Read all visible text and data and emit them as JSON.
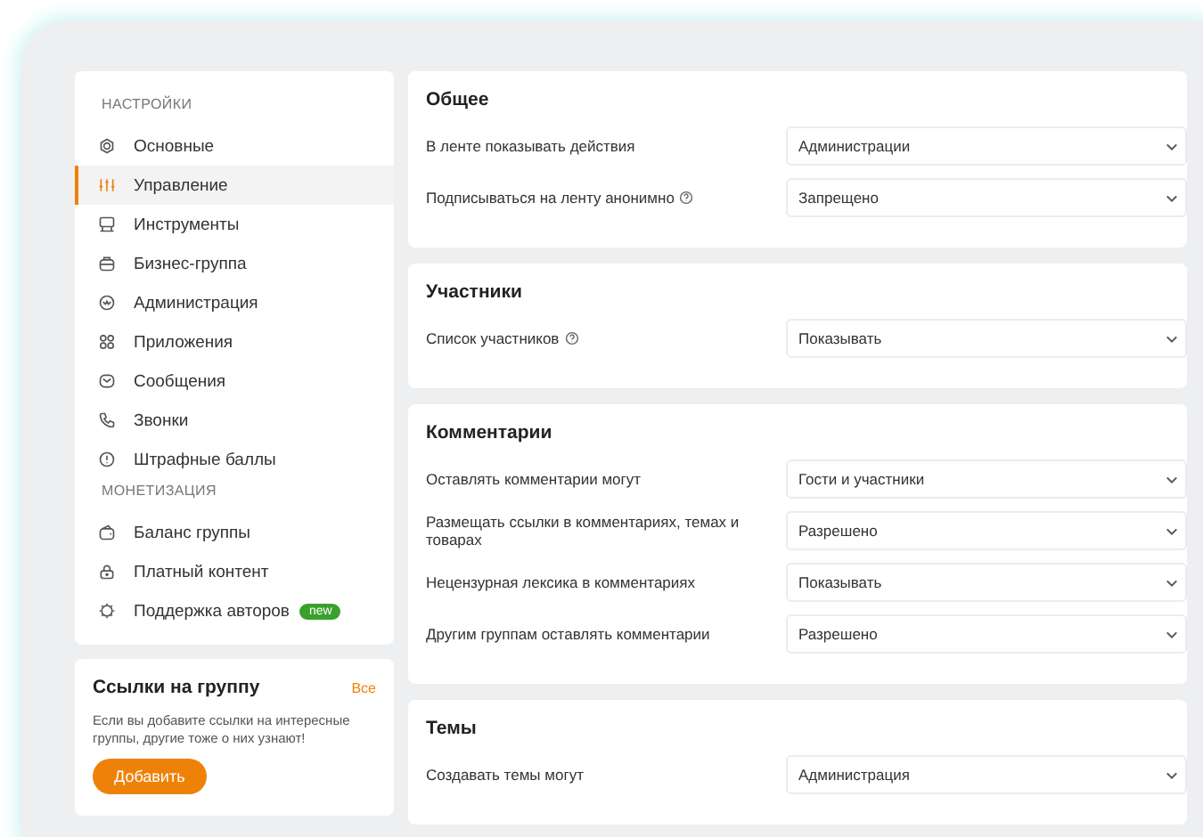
{
  "sidebar": {
    "groups": [
      {
        "title": "НАСТРОЙКИ",
        "items": [
          {
            "label": "Основные",
            "selected": false
          },
          {
            "label": "Управление",
            "selected": true
          },
          {
            "label": "Инструменты",
            "selected": false
          },
          {
            "label": "Бизнес-группа",
            "selected": false
          },
          {
            "label": "Администрация",
            "selected": false
          },
          {
            "label": "Приложения",
            "selected": false
          },
          {
            "label": "Сообщения",
            "selected": false
          },
          {
            "label": "Звонки",
            "selected": false
          },
          {
            "label": "Штрафные баллы",
            "selected": false
          }
        ]
      },
      {
        "title": "МОНЕТИЗАЦИЯ",
        "items": [
          {
            "label": "Баланс группы",
            "selected": false
          },
          {
            "label": "Платный контент",
            "selected": false
          },
          {
            "label": "Поддержка авторов",
            "selected": false,
            "badge": "new"
          }
        ]
      }
    ]
  },
  "links_card": {
    "title": "Ссылки на группу",
    "all_link": "Все",
    "text": "Если вы добавите ссылки на интересные группы, другие тоже о них узнают!",
    "button": "Добавить"
  },
  "sections": [
    {
      "title": "Общее",
      "rows": [
        {
          "label": "В ленте показывать действия",
          "help": false,
          "value": "Администрации"
        },
        {
          "label": "Подписываться на ленту анонимно",
          "help": true,
          "value": "Запрещено"
        }
      ]
    },
    {
      "title": "Участники",
      "rows": [
        {
          "label": "Список участников",
          "help": true,
          "value": "Показывать"
        }
      ]
    },
    {
      "title": "Комментарии",
      "rows": [
        {
          "label": "Оставлять комментарии могут",
          "help": false,
          "value": "Гости и участники"
        },
        {
          "label": "Размещать ссылки в комментариях, темах и товарах",
          "help": false,
          "value": "Разрешено"
        },
        {
          "label": "Нецензурная лексика в комментариях",
          "help": false,
          "value": "Показывать"
        },
        {
          "label": "Другим группам оставлять комментарии",
          "help": false,
          "value": "Разрешено"
        }
      ]
    },
    {
      "title": "Темы",
      "rows": [
        {
          "label": "Создавать темы могут",
          "help": false,
          "value": "Администрация"
        }
      ]
    }
  ]
}
